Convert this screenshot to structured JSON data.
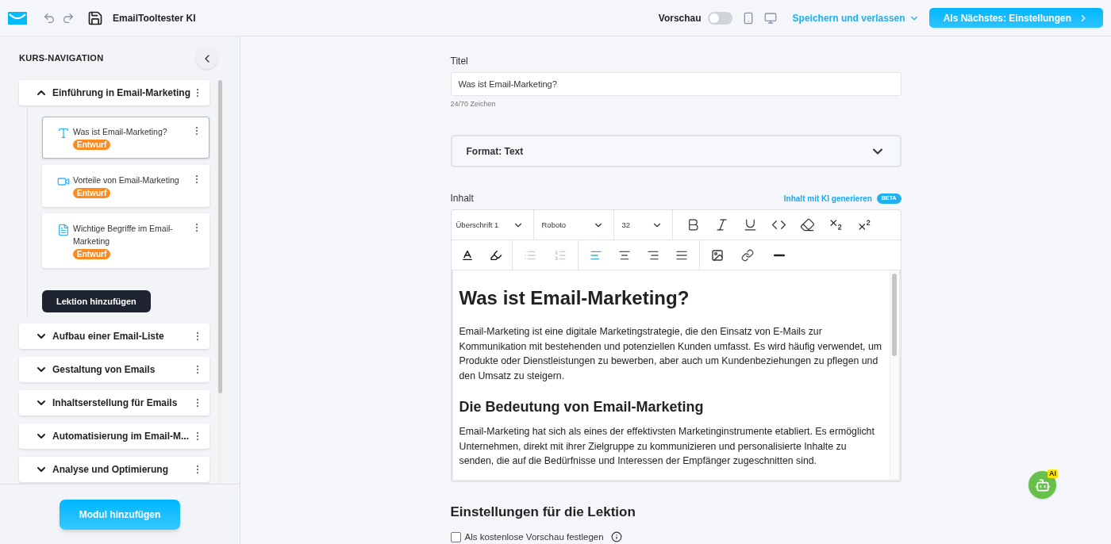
{
  "header": {
    "title": "EmailTooltester KI",
    "preview_label": "Vorschau",
    "preview_on": false,
    "save_menu": "Speichern und verlassen",
    "next_button": "Als Nächstes: Einstellungen"
  },
  "sidebar": {
    "title": "KURS-NAVIGATION",
    "add_lesson": "Lektion hinzufügen",
    "add_module": "Modul hinzufügen",
    "modules": [
      {
        "title": "Einführung in Email-Marketing",
        "expanded": true,
        "lessons": [
          {
            "kind": "text",
            "title": "Was ist Email-Marketing?",
            "status": "Entwurf",
            "selected": true
          },
          {
            "kind": "video",
            "title": "Vorteile von Email-Marketing",
            "status": "Entwurf",
            "selected": false
          },
          {
            "kind": "pdf",
            "title": "Wichtige Begriffe im Email-Marketing",
            "status": "Entwurf",
            "selected": false
          }
        ]
      },
      {
        "title": "Aufbau einer Email-Liste",
        "expanded": false
      },
      {
        "title": "Gestaltung von Emails",
        "expanded": false
      },
      {
        "title": "Inhaltserstellung für Emails",
        "expanded": false
      },
      {
        "title": "Automatisierung im Email-M...",
        "expanded": false
      },
      {
        "title": "Analyse und Optimierung",
        "expanded": false
      }
    ]
  },
  "form": {
    "title_label": "Titel",
    "title_value": "Was ist Email-Marketing?",
    "char_count": "24/70 Zeichen",
    "format": "Format: Text",
    "content_label": "Inhalt",
    "ai_link": "Inhalt mit KI generieren",
    "ai_badge": "BETA",
    "toolbar": {
      "dropdowns": [
        "Überschrift 1",
        "Roboto",
        "32"
      ],
      "lists": [
        {
          "kind": "bullet",
          "disabled": true
        },
        {
          "kind": "numbered",
          "disabled": true
        }
      ],
      "aligns": [
        {
          "kind": "left",
          "selected": true
        },
        {
          "kind": "center",
          "selected": false
        },
        {
          "kind": "right",
          "selected": false
        },
        {
          "kind": "justify",
          "selected": false
        }
      ]
    },
    "content": [
      {
        "kind": "h1",
        "text": "Was ist Email-Marketing?"
      },
      {
        "kind": "p",
        "text": "Email-Marketing ist eine digitale Marketingstrategie, die den Einsatz von E-Mails zur Kommunikation mit bestehenden und potenziellen Kunden umfasst. Es wird häufig verwendet, um Produkte oder Dienstleistungen zu bewerben, aber auch um Kundenbeziehungen zu pflegen und den Umsatz zu steigern."
      },
      {
        "kind": "h2",
        "text": "Die Bedeutung von Email-Marketing"
      },
      {
        "kind": "p",
        "text": "Email-Marketing hat sich als eines der effektivsten Marketinginstrumente etabliert. Es ermöglicht Unternehmen, direkt mit ihrer Zielgruppe zu kommunizieren und personalisierte Inhalte zu senden, die auf die Bedürfnisse und Interessen der Empfänger zugeschnitten sind."
      }
    ],
    "settings_title": "Einstellungen für die Lektion",
    "free_preview": {
      "label": "Als kostenlose Vorschau festlegen",
      "checked": false
    }
  },
  "assistant": {
    "badge": "AI"
  }
}
